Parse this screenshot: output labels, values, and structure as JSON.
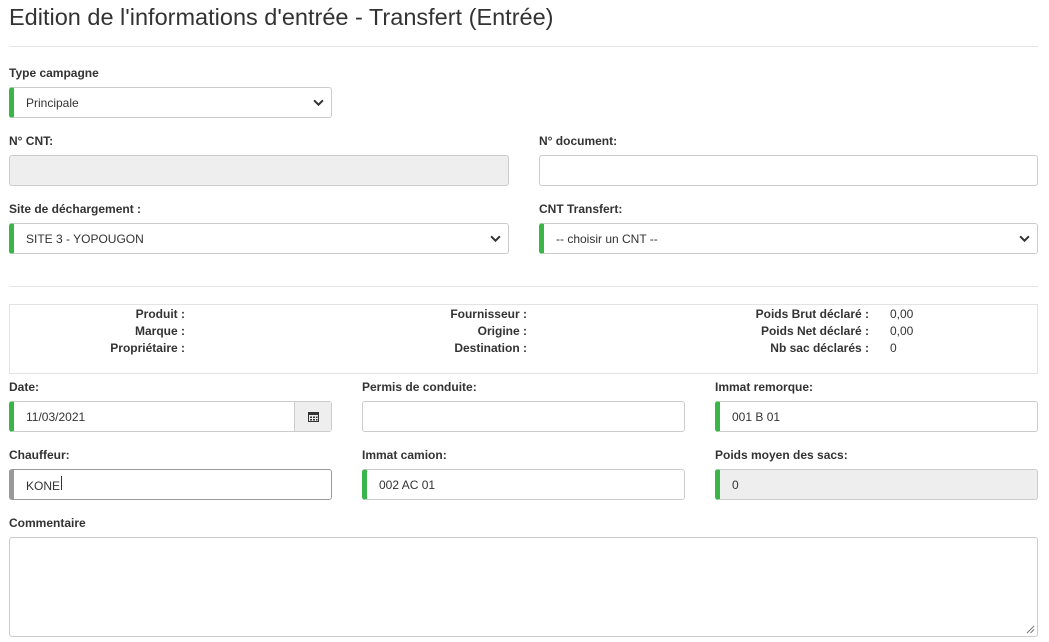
{
  "page_title": "Edition de l'informations d'entrée - Transfert (Entrée)",
  "type_campagne": {
    "label": "Type campagne",
    "value": "Principale"
  },
  "no_cnt": {
    "label": "N° CNT:",
    "value": ""
  },
  "no_document": {
    "label": "N° document:",
    "value": ""
  },
  "site_dechargement": {
    "label": "Site de déchargement :",
    "value": "SITE 3 - YOPOUGON"
  },
  "cnt_transfert": {
    "label": "CNT Transfert:",
    "value": "-- choisir un CNT --"
  },
  "info": {
    "produit_label": "Produit :",
    "marque_label": "Marque :",
    "proprietaire_label": "Propriétaire :",
    "fournisseur_label": "Fournisseur :",
    "origine_label": "Origine :",
    "destination_label": "Destination :",
    "poids_brut_label": "Poids Brut déclaré :",
    "poids_brut_value": "0,00",
    "poids_net_label": "Poids Net déclaré :",
    "poids_net_value": "0,00",
    "nb_sac_label": "Nb sac déclarés :",
    "nb_sac_value": "0"
  },
  "date": {
    "label": "Date:",
    "value": "11/03/2021"
  },
  "permis": {
    "label": "Permis de conduite:",
    "value": ""
  },
  "immat_remorque": {
    "label": "Immat remorque:",
    "value": "001 B 01"
  },
  "chauffeur": {
    "label": "Chauffeur:",
    "value": "KONE"
  },
  "immat_camion": {
    "label": "Immat camion:",
    "value": "002 AC 01"
  },
  "poids_moyen": {
    "label": "Poids moyen des sacs:",
    "value": "0"
  },
  "commentaire": {
    "label": "Commentaire",
    "value": ""
  },
  "colors": {
    "required_accent": "#3ab54a",
    "readonly_bg": "#eeeeee",
    "border": "#cccccc"
  },
  "icons": {
    "select_arrow": "chevron-down-icon",
    "date_picker": "calendar-icon",
    "resize": "resize-handle-icon"
  }
}
